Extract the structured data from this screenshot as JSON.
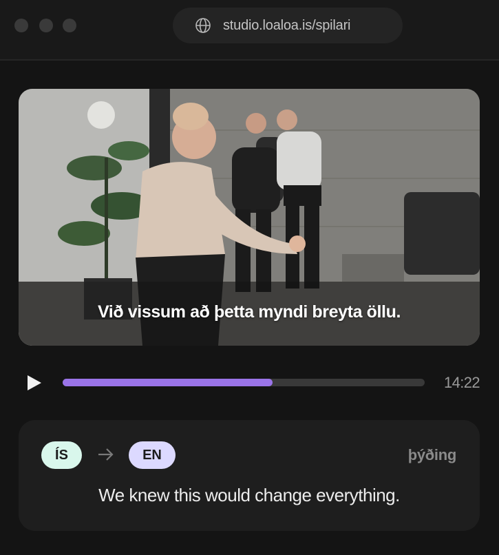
{
  "browser": {
    "url": "studio.loaloa.is/spilari",
    "globe_icon": "globe-icon",
    "window_dots": [
      "close",
      "minimize",
      "maximize"
    ]
  },
  "video": {
    "subtitle": "Við vissum að þetta myndi breyta öllu."
  },
  "player": {
    "play_icon": "play-icon",
    "progress_fraction": 0.58,
    "time": "14:22",
    "accent": "#9a74e8"
  },
  "translation": {
    "source_lang": "ÍS",
    "target_lang": "EN",
    "arrow_icon": "arrow-right-icon",
    "label": "þýðing",
    "text": "We knew this would change everything.",
    "source_color": "#d9f7ec",
    "target_color": "#dcd9ff"
  }
}
